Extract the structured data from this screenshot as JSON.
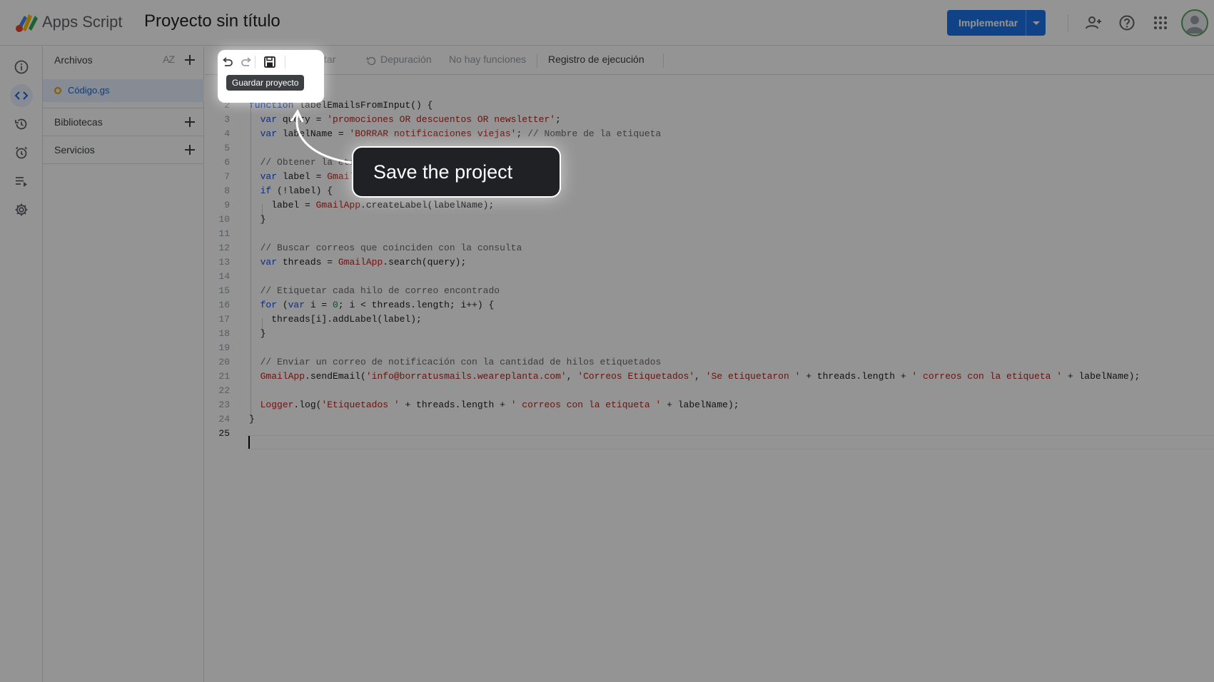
{
  "header": {
    "brand": "Apps Script",
    "project_title": "Proyecto sin título",
    "deploy_label": "Implementar"
  },
  "rail": {
    "icons": [
      "info-icon",
      "code-icon",
      "history-icon",
      "alarm-icon",
      "executions-icon",
      "settings-icon"
    ],
    "active": "code-icon"
  },
  "files": {
    "title": "Archivos",
    "sort_label": "AZ",
    "items": [
      {
        "name": "Código.gs"
      }
    ],
    "libraries": "Bibliotecas",
    "services": "Servicios"
  },
  "toolbar": {
    "run": "Ejecutar",
    "debug": "Depuración",
    "no_functions": "No hay funciones",
    "execution_log": "Registro de ejecución"
  },
  "editor": {
    "line_numbers": [
      "1",
      "2",
      "3",
      "4",
      "5",
      "6",
      "7",
      "8",
      "9",
      "10",
      "11",
      "12",
      "13",
      "14",
      "15",
      "16",
      "17",
      "18",
      "19",
      "20",
      "21",
      "22",
      "23",
      "24",
      "25"
    ],
    "lines": [
      "",
      "function labelEmailsFromInput() {",
      "  var query = 'promociones OR descuentos OR newsletter';",
      "  var labelName = 'BORRAR notificaciones viejas'; // Nombre de la etiqueta",
      "",
      "  // Obtener la etiqueta o crearla si no existe",
      "  var label = GmailApp.getUserLabelByName(labelName);",
      "  if (!label) {",
      "    label = GmailApp.createLabel(labelName);",
      "  }",
      "",
      "  // Buscar correos que coinciden con la consulta",
      "  var threads = GmailApp.search(query);",
      "",
      "  // Etiquetar cada hilo de correo encontrado",
      "  for (var i = 0; i < threads.length; i++) {",
      "    threads[i].addLabel(label);",
      "  }",
      "",
      "  // Enviar un correo de notificación con la cantidad de hilos etiquetados",
      "  GmailApp.sendEmail('info@borratusmails.weareplanta.com', 'Correos Etiquetados', 'Se etiquetaron ' + threads.length + ' correos con la etiqueta ' + labelName);",
      "",
      "  Logger.log('Etiquetados ' + threads.length + ' correos con la etiqueta ' + labelName);",
      "}",
      ""
    ],
    "current_line": "25"
  },
  "tooltip": "Guardar proyecto",
  "callout": "Save the project",
  "colors": {
    "accent": "#1a73e8",
    "keyword": "#1a4fd6",
    "string": "#b3261e"
  }
}
